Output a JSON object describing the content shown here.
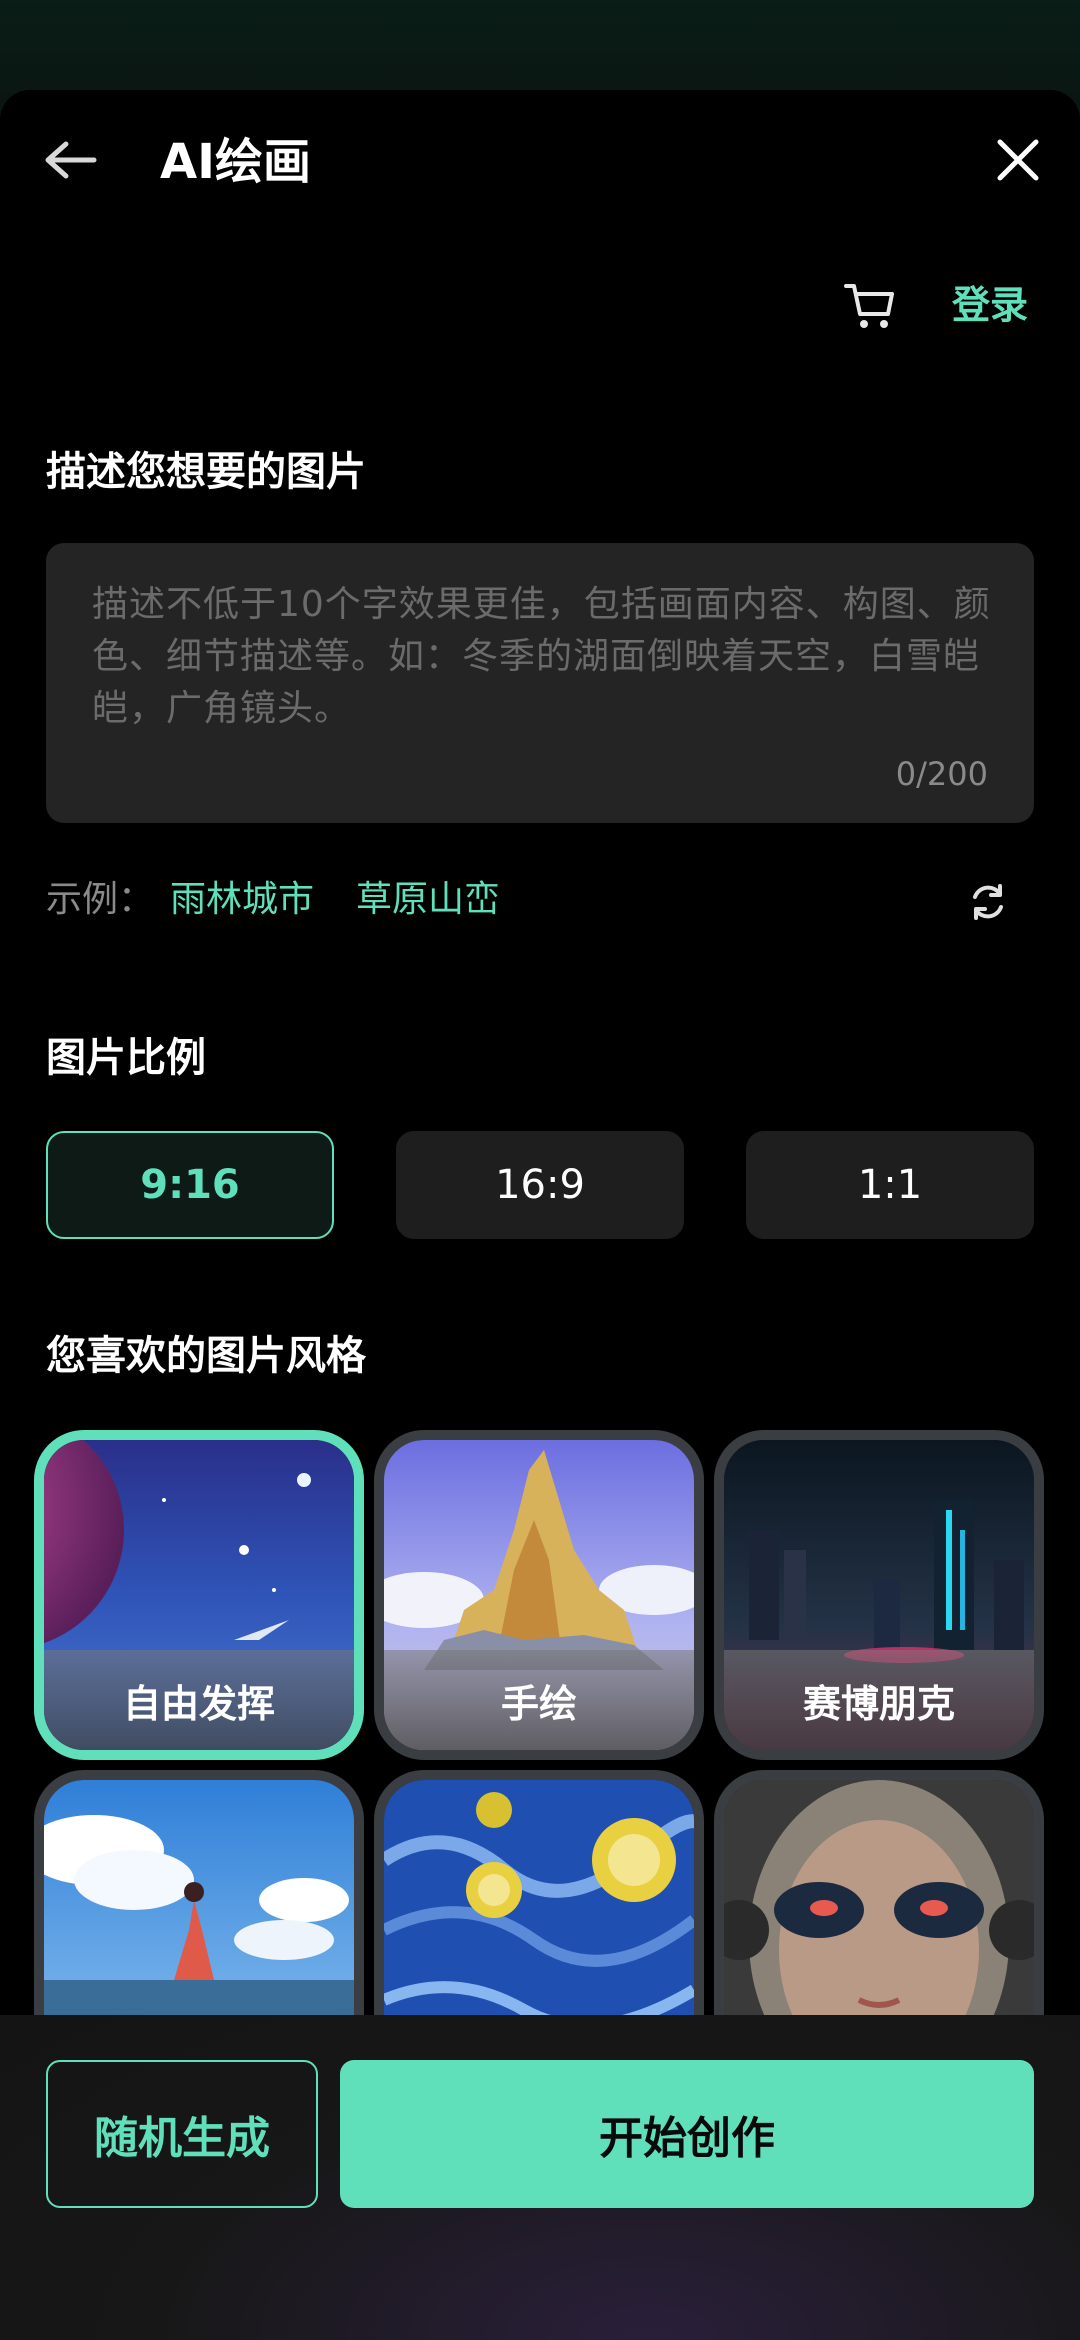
{
  "header": {
    "title": "AI绘画",
    "login_label": "登录"
  },
  "prompt": {
    "section_title": "描述您想要的图片",
    "placeholder": "描述不低于10个字效果更佳，包括画面内容、构图、颜色、细节描述等。如：冬季的湖面倒映着天空，白雪皑皑，广角镜头。",
    "counter": "0/200",
    "examples_label": "示例：",
    "examples": [
      "雨林城市",
      "草原山峦"
    ]
  },
  "ratio": {
    "section_title": "图片比例",
    "options": [
      "9:16",
      "16:9",
      "1:1"
    ],
    "selected": "9:16"
  },
  "styles": {
    "section_title": "您喜欢的图片风格",
    "items": [
      "自由发挥",
      "手绘",
      "赛博朋克",
      "",
      "",
      ""
    ],
    "selected": "自由发挥"
  },
  "actions": {
    "random_label": "随机生成",
    "start_label": "开始创作"
  },
  "colors": {
    "accent": "#5fe0bb",
    "background": "#000000",
    "input_bg": "#242424"
  },
  "icons": [
    "back-arrow-icon",
    "close-icon",
    "cart-icon",
    "refresh-icon"
  ]
}
